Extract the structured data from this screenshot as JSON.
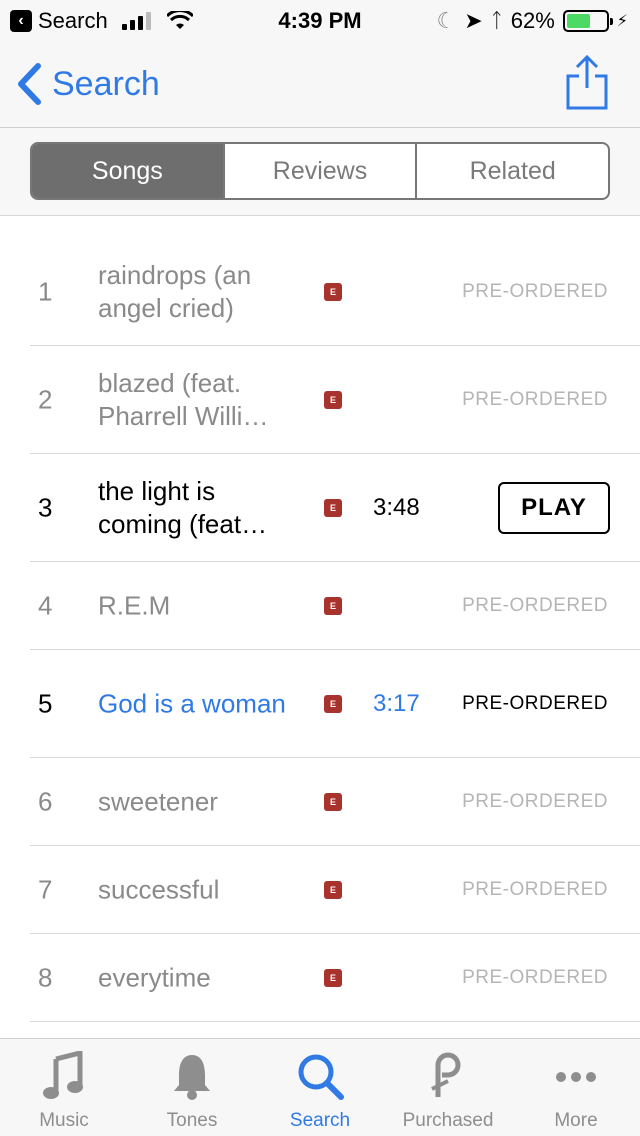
{
  "status_bar": {
    "back_app_label": "Search",
    "time": "4:39 PM",
    "battery": "62%",
    "battery_level": 0.62,
    "colors": {
      "battery": "#4cd964"
    }
  },
  "nav": {
    "back_label": "Search"
  },
  "segments": [
    {
      "label": "Songs",
      "active": true
    },
    {
      "label": "Reviews",
      "active": false
    },
    {
      "label": "Related",
      "active": false
    }
  ],
  "tracks": [
    {
      "num": "1",
      "title": "raindrops (an angel cried)",
      "duration": "",
      "status": "PRE-ORDERED"
    },
    {
      "num": "2",
      "title": "blazed (feat. Pharrell Willi…",
      "duration": "",
      "status": "PRE-ORDERED"
    },
    {
      "num": "3",
      "title": "the light is coming (feat…",
      "duration": "3:48",
      "button": "PLAY"
    },
    {
      "num": "4",
      "title": "R.E.M",
      "duration": "",
      "status": "PRE-ORDERED"
    },
    {
      "num": "5",
      "title": "God is a woman",
      "duration": "3:17",
      "status": "PRE-ORDERED"
    },
    {
      "num": "6",
      "title": "sweetener",
      "duration": "",
      "status": "PRE-ORDERED"
    },
    {
      "num": "7",
      "title": "successful",
      "duration": "",
      "status": "PRE-ORDERED"
    },
    {
      "num": "8",
      "title": "everytime",
      "duration": "",
      "status": "PRE-ORDERED"
    }
  ],
  "tabs": [
    {
      "label": "Music",
      "icon": "music-note-icon"
    },
    {
      "label": "Tones",
      "icon": "bell-icon"
    },
    {
      "label": "Search",
      "icon": "search-icon",
      "active": true
    },
    {
      "label": "Purchased",
      "icon": "purchased-icon"
    },
    {
      "label": "More",
      "icon": "more-dots-icon"
    }
  ],
  "colors": {
    "accent": "#2f7ae5",
    "explicit": "#a8322c"
  }
}
